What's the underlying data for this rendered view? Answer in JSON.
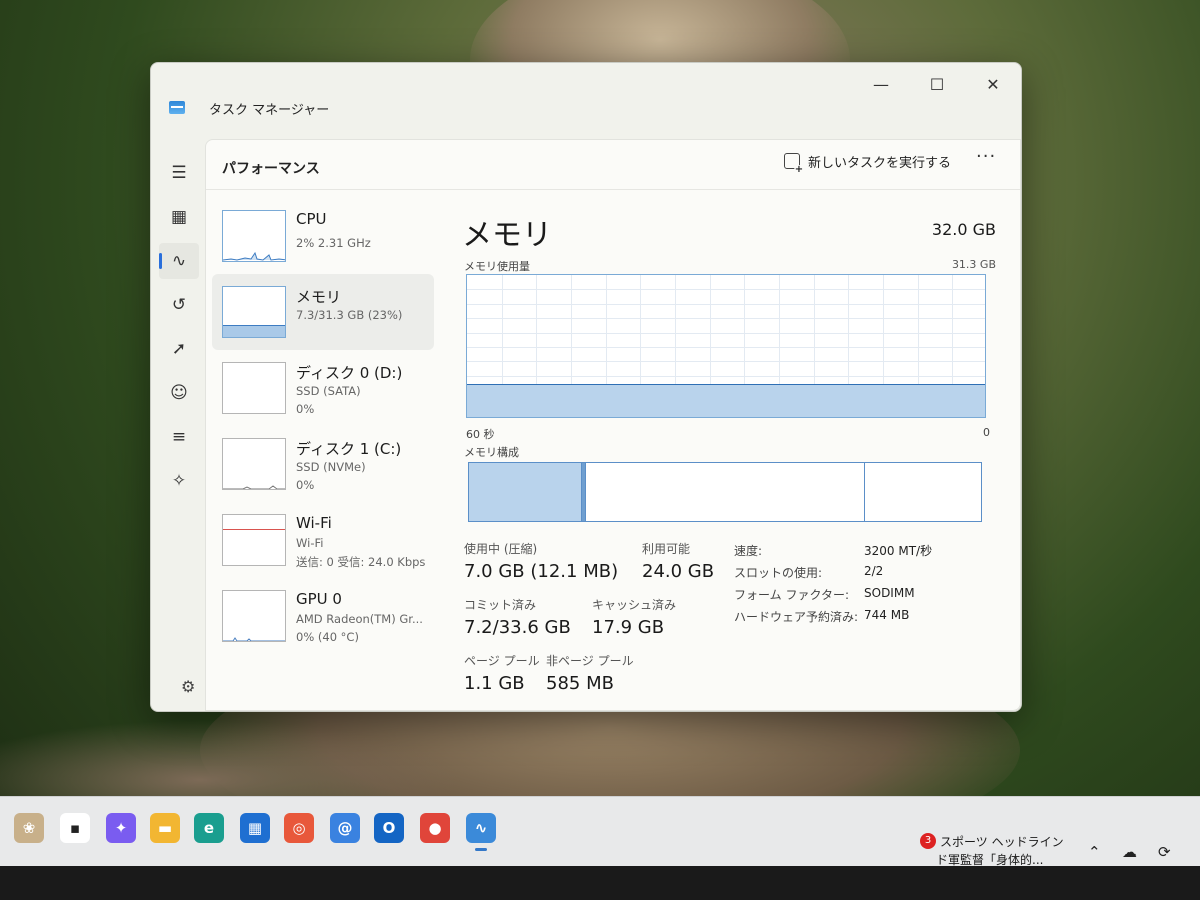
{
  "window": {
    "title": "タスク マネージャー",
    "minimize": "—",
    "maximize": "☐",
    "close": "✕"
  },
  "nav": {
    "items": [
      {
        "name": "hamburger-icon",
        "glyph": "☰"
      },
      {
        "name": "processes-icon",
        "glyph": "▦"
      },
      {
        "name": "performance-icon",
        "glyph": "∿"
      },
      {
        "name": "app-history-icon",
        "glyph": "↺"
      },
      {
        "name": "startup-apps-icon",
        "glyph": "➚"
      },
      {
        "name": "users-icon",
        "glyph": "☺"
      },
      {
        "name": "details-icon",
        "glyph": "≡"
      },
      {
        "name": "services-icon",
        "glyph": "✧"
      }
    ],
    "settings_glyph": "⚙"
  },
  "header": {
    "page_title": "パフォーマンス",
    "run_new_task": "新しいタスクを実行する",
    "more": "···"
  },
  "perf_list": [
    {
      "name": "CPU",
      "sub1": "2% 2.31 GHz",
      "sub2": ""
    },
    {
      "name": "メモリ",
      "sub1": "7.3/31.3 GB (23%)",
      "sub2": ""
    },
    {
      "name": "ディスク 0 (D:)",
      "sub1": "SSD (SATA)",
      "sub2": "0%"
    },
    {
      "name": "ディスク 1 (C:)",
      "sub1": "SSD (NVMe)",
      "sub2": "0%"
    },
    {
      "name": "Wi-Fi",
      "sub1": "Wi-Fi",
      "sub2": "送信: 0 受信: 24.0 Kbps"
    },
    {
      "name": "GPU 0",
      "sub1": "AMD Radeon(TM) Gr...",
      "sub2": "0% (40 °C)"
    }
  ],
  "detail": {
    "title": "メモリ",
    "total": "32.0 GB",
    "usage_label": "メモリ使用量",
    "usage_max": "31.3 GB",
    "axis_left": "60 秒",
    "axis_right": "0",
    "usage_fraction": 0.23,
    "composition_label": "メモリ構成",
    "composition_fractions": [
      0.22,
      0.008,
      0.545,
      0.21
    ],
    "stats": {
      "in_use_label": "使用中 (圧縮)",
      "in_use_value": "7.0 GB (12.1 MB)",
      "available_label": "利用可能",
      "available_value": "24.0 GB",
      "committed_label": "コミット済み",
      "committed_value": "7.2/33.6 GB",
      "cached_label": "キャッシュ済み",
      "cached_value": "17.9 GB",
      "paged_label": "ページ プール",
      "paged_value": "1.1 GB",
      "nonpaged_label": "非ページ プール",
      "nonpaged_value": "585 MB"
    },
    "specs": [
      {
        "label": "速度:",
        "value": "3200 MT/秒"
      },
      {
        "label": "スロットの使用:",
        "value": "2/2"
      },
      {
        "label": "フォーム ファクター:",
        "value": "SODIMM"
      },
      {
        "label": "ハードウェア予約済み:",
        "value": "744 MB"
      }
    ]
  },
  "colors": {
    "accent": "#2a6fdb",
    "graph_border": "#7aaad6",
    "graph_fill": "#b9d3ec",
    "wifi_line": "#d9534f"
  },
  "taskbar": {
    "icons": [
      {
        "name": "widgets-icon",
        "glyph": "❀",
        "bg": "#c8b08a"
      },
      {
        "name": "task-view-icon",
        "glyph": "▪",
        "bg": "#ffffff"
      },
      {
        "name": "copilot-icon",
        "glyph": "✦",
        "bg": "#7a5cf0"
      },
      {
        "name": "file-explorer-icon",
        "glyph": "▬",
        "bg": "#f2b632"
      },
      {
        "name": "edge-icon",
        "glyph": "e",
        "bg": "#1a9e8f"
      },
      {
        "name": "store-icon",
        "glyph": "▦",
        "bg": "#1f6fd1"
      },
      {
        "name": "recorder-icon",
        "glyph": "◎",
        "bg": "#e8583b"
      },
      {
        "name": "mail-icon",
        "glyph": "@",
        "bg": "#3a82e0"
      },
      {
        "name": "outlook-icon",
        "glyph": "O",
        "bg": "#1465c4"
      },
      {
        "name": "chrome-icon",
        "glyph": "●",
        "bg": "#e0453a"
      },
      {
        "name": "task-manager-icon",
        "glyph": "∿",
        "bg": "#3b8ad9"
      }
    ],
    "news_badge": "3",
    "news_title": "スポーツ ヘッドライン",
    "news_sub": "ド軍監督「身体的...",
    "tray": [
      {
        "name": "chevron-up-icon",
        "glyph": "⌃"
      },
      {
        "name": "onedrive-icon",
        "glyph": "☁"
      },
      {
        "name": "sync-icon",
        "glyph": "⟳"
      }
    ]
  }
}
